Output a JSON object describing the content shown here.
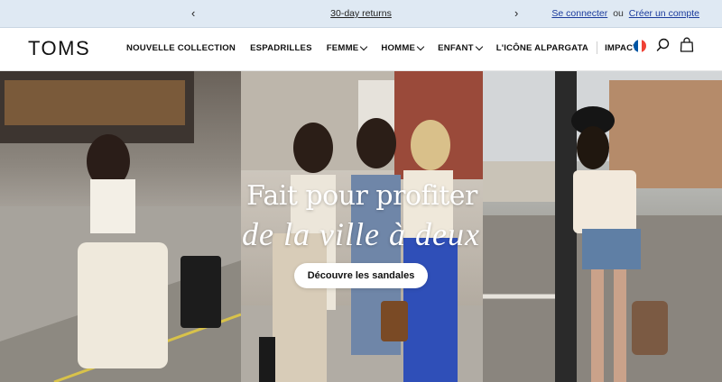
{
  "announcement": {
    "prev_label": "‹",
    "next_label": "›",
    "promo_text": "30-day returns",
    "signin_label": "Se connecter",
    "separator": "ou",
    "create_account_label": "Créer un compte"
  },
  "brand": {
    "logo_text": "TOMS"
  },
  "nav": {
    "items": [
      {
        "label": "NOUVELLE COLLECTION",
        "has_dropdown": false
      },
      {
        "label": "ESPADRILLES",
        "has_dropdown": false
      },
      {
        "label": "FEMME",
        "has_dropdown": true
      },
      {
        "label": "HOMME",
        "has_dropdown": true
      },
      {
        "label": "ENFANT",
        "has_dropdown": true
      },
      {
        "label": "L'ICÔNE ALPARGATA",
        "has_dropdown": false
      },
      {
        "label": "IMPACT",
        "has_dropdown": false
      }
    ]
  },
  "header_icons": [
    "france-flag-icon",
    "search-icon",
    "shopping-bag-icon"
  ],
  "hero": {
    "title": "Fait pour profiter",
    "subtitle": "de la ville à deux",
    "cta_label": "Découvre les sandales"
  },
  "colors": {
    "announcement_bg": "#dfe9f3",
    "link": "#1a3a9c",
    "flag_blue": "#0055a4",
    "flag_white": "#ffffff",
    "flag_red": "#ef4135"
  }
}
